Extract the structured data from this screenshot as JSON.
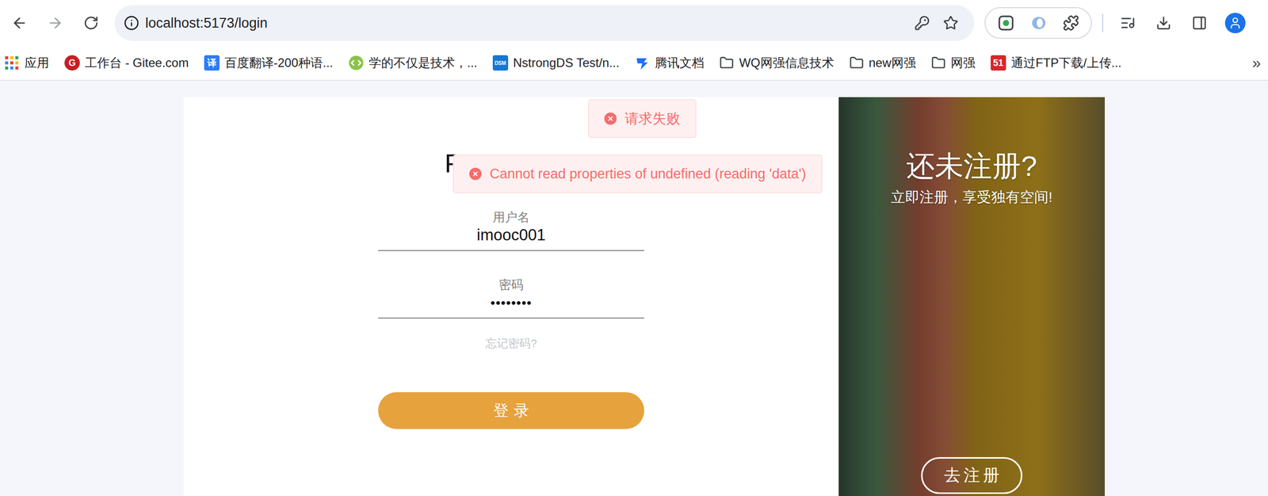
{
  "browser": {
    "url": "localhost:5173/login",
    "overflow": "»"
  },
  "bookmarks": [
    {
      "label": "应用",
      "kind": "apps",
      "icon_text": ""
    },
    {
      "label": "工作台 - Gitee.com",
      "kind": "gitee",
      "icon_text": "G"
    },
    {
      "label": "百度翻译-200种语...",
      "kind": "fanyi",
      "icon_text": "译"
    },
    {
      "label": "学的不仅是技术，...",
      "kind": "code",
      "icon_text": ""
    },
    {
      "label": "NstrongDS Test/n...",
      "kind": "dsm",
      "icon_text": "DSM"
    },
    {
      "label": "腾讯文档",
      "kind": "tencent",
      "icon_text": ""
    },
    {
      "label": "WQ网强信息技术",
      "kind": "folder",
      "icon_text": ""
    },
    {
      "label": "new网强",
      "kind": "folder",
      "icon_text": ""
    },
    {
      "label": "网强",
      "kind": "folder",
      "icon_text": ""
    },
    {
      "label": "通过FTP下载/上传...",
      "kind": "ftp",
      "icon_text": "51"
    }
  ],
  "login": {
    "title": "F",
    "fields": [
      {
        "label": "用户名",
        "value": "imooc001",
        "kind": "text"
      },
      {
        "label": "密码",
        "value": "••••••••",
        "kind": "password"
      }
    ],
    "forgot": "忘记密码?",
    "submit": "登录"
  },
  "register": {
    "title": "还未注册?",
    "subtitle": "立即注册，享受独有空间!",
    "button": "去注册"
  },
  "messages": [
    {
      "text": "请求失败",
      "type": "error"
    },
    {
      "text": "Cannot read properties of undefined (reading 'data')",
      "type": "error"
    }
  ]
}
